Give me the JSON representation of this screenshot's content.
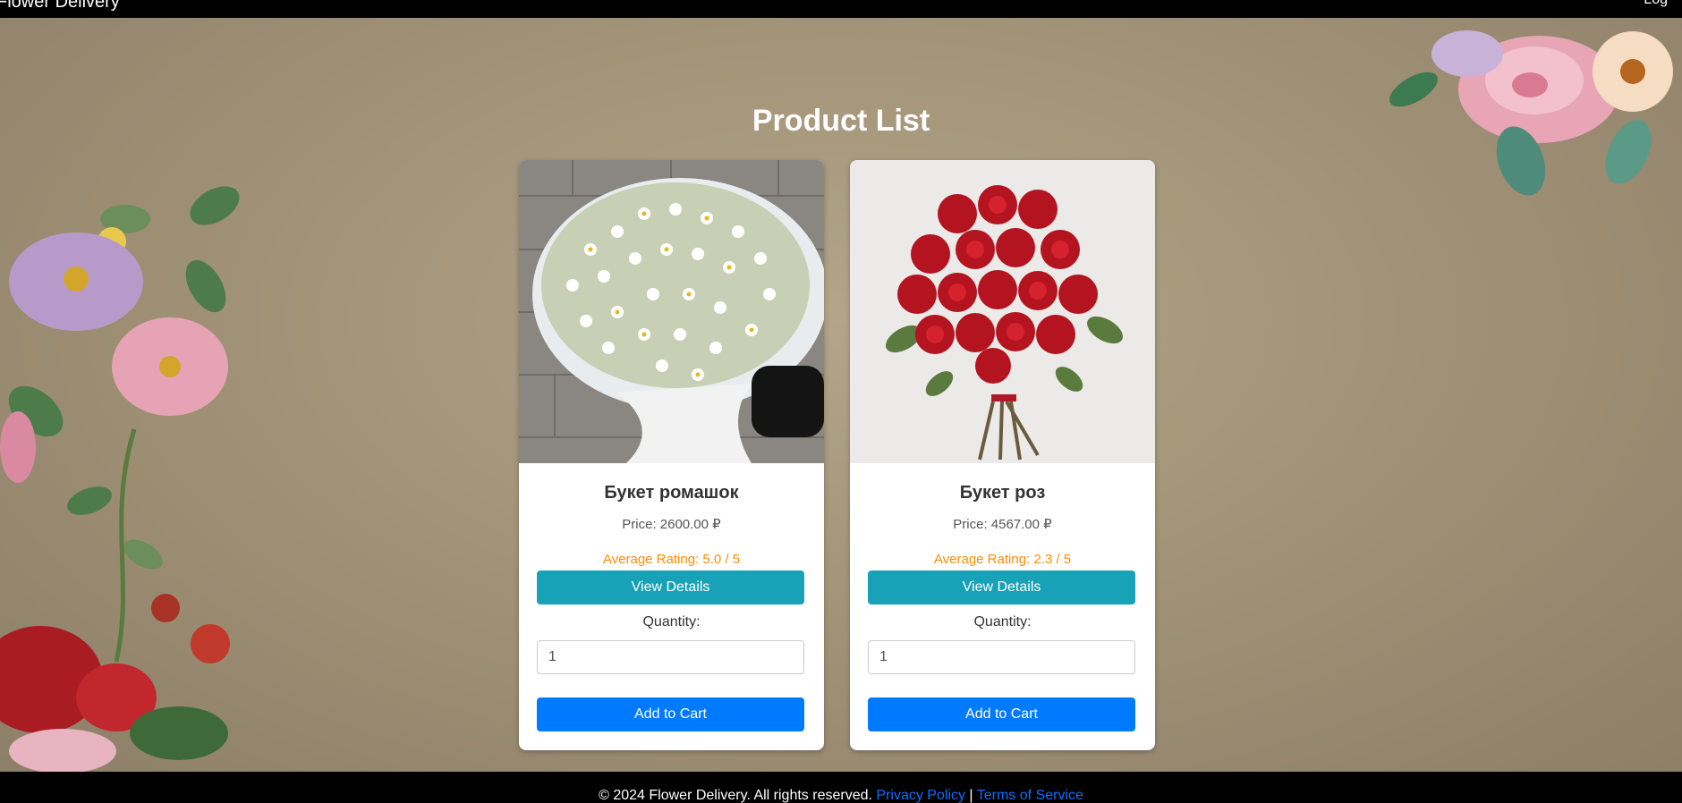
{
  "header": {
    "brand": "Flower Delivery",
    "right_link": "Log"
  },
  "page": {
    "title": "Product List"
  },
  "products": [
    {
      "name": "Букет ромашок",
      "price": "Price: 2600.00 ₽",
      "rating": "Average Rating: 5.0 / 5",
      "details_label": "View Details",
      "quantity_label": "Quantity:",
      "quantity_value": "1",
      "cart_label": "Add to Cart"
    },
    {
      "name": "Букет роз",
      "price": "Price: 4567.00 ₽",
      "rating": "Average Rating: 2.3 / 5",
      "details_label": "View Details",
      "quantity_label": "Quantity:",
      "quantity_value": "1",
      "cart_label": "Add to Cart"
    }
  ],
  "footer": {
    "copyright": "© 2024 Flower Delivery. All rights reserved.",
    "privacy": "Privacy Policy",
    "separator": "|",
    "terms": "Terms of Service"
  },
  "colors": {
    "info_button": "#17a2b8",
    "primary_button": "#007bff",
    "rating": "#ff8c00",
    "link": "#0d6efd"
  }
}
